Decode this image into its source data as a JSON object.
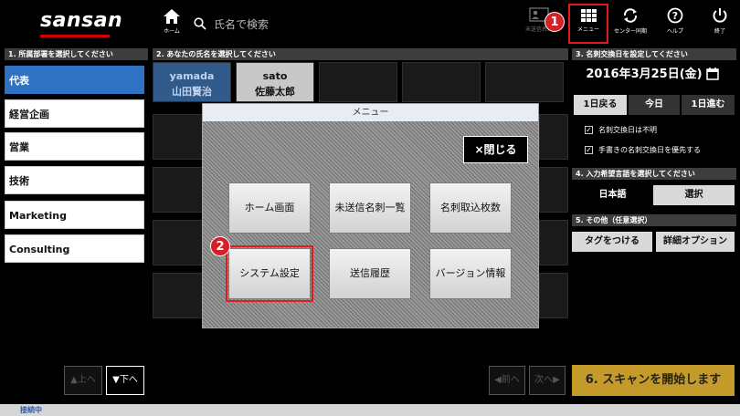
{
  "header": {
    "logo": "sansan",
    "home_label": "ホーム",
    "search_placeholder": "氏名で検索",
    "unsent_label": "未送信名刺",
    "tools": [
      {
        "label": "メニュー",
        "icon": "grid-icon"
      },
      {
        "label": "センター同期",
        "icon": "sync-icon"
      },
      {
        "label": "ヘルプ",
        "icon": "help-icon"
      },
      {
        "label": "終了",
        "icon": "power-icon"
      }
    ]
  },
  "annotations": {
    "badge1": "1",
    "badge2": "2"
  },
  "departments": {
    "header": "1. 所属部署を選択してください",
    "items": [
      "代表",
      "経営企画",
      "営業",
      "技術",
      "Marketing",
      "Consulting"
    ],
    "selected_index": 0
  },
  "names": {
    "header": "2. あなたの氏名を選択してください",
    "items": [
      {
        "romaji": "yamada",
        "kanji": "山田賢治",
        "selected": true
      },
      {
        "romaji": "sato",
        "kanji": "佐藤太郎",
        "selected": false
      }
    ]
  },
  "date_section": {
    "header": "3. 名刺交換日を設定してください",
    "date": "2016年3月25日(金)",
    "prev_day": "1日戻る",
    "today": "今日",
    "next_day": "1日進む",
    "checks": [
      "名刺交換日は不明",
      "手書きの名刺交換日を優先する"
    ]
  },
  "language_section": {
    "header": "4. 入力希望言語を選択してください",
    "value": "日本語",
    "select_label": "選択"
  },
  "other_section": {
    "header": "5. その他（任意選択）",
    "tag_button": "タグをつける",
    "detail_button": "詳細オプション"
  },
  "bottom": {
    "up": "上へ",
    "down": "下へ",
    "prev": "前へ",
    "next": "次へ",
    "scan": "6. スキャンを開始します",
    "status": "接続中"
  },
  "modal": {
    "title": "メニュー",
    "close": "×閉じる",
    "buttons": [
      "ホーム画面",
      "未送信名刺一覧",
      "名刺取込枚数",
      "システム設定",
      "送信履歴",
      "バージョン情報"
    ],
    "highlighted_index": 3
  },
  "colors": {
    "accent_red": "#e21b1b",
    "selected_blue": "#2f71c2",
    "scan_gold": "#c49a2a"
  }
}
